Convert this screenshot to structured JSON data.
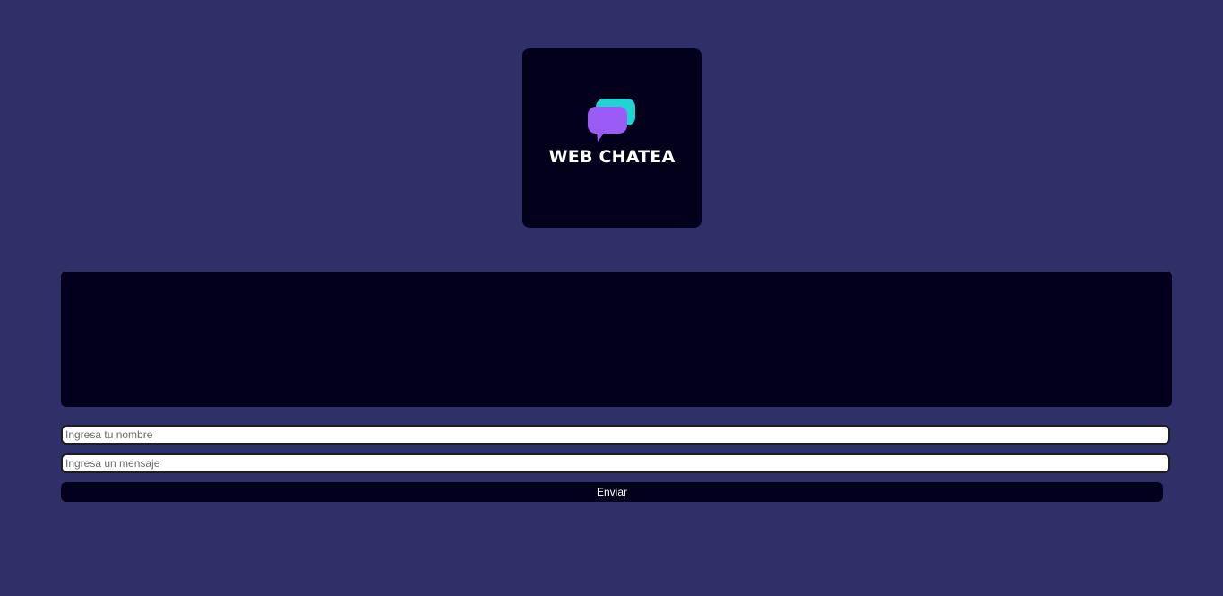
{
  "logo": {
    "text": "WEB CHATEA",
    "icon": "chat-bubbles-icon",
    "colors": {
      "front_bubble": "#9b5cf6",
      "back_bubble": "#22d3d3",
      "card_background": "#02001a"
    }
  },
  "form": {
    "name_placeholder": "Ingresa tu nombre",
    "message_placeholder": "Ingresa un mensaje",
    "send_label": "Enviar"
  },
  "theme": {
    "page_background": "#303068",
    "panel_background": "#02001a"
  }
}
